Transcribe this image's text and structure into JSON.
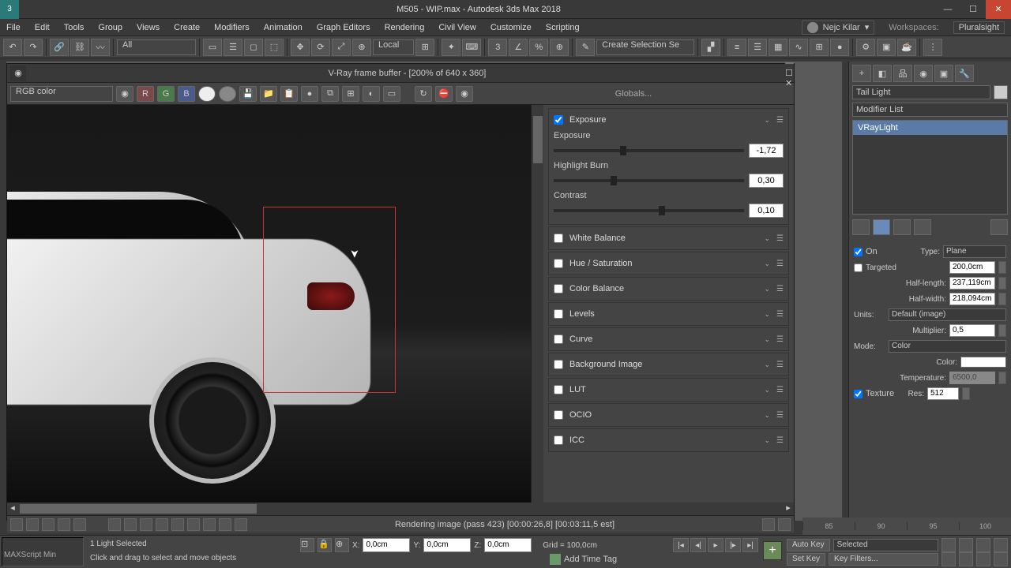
{
  "app": {
    "title": "M505 - WIP.max - Autodesk 3ds Max 2018"
  },
  "menu": {
    "items": [
      "File",
      "Edit",
      "Tools",
      "Group",
      "Views",
      "Create",
      "Modifiers",
      "Animation",
      "Graph Editors",
      "Rendering",
      "Civil View",
      "Customize",
      "Scripting"
    ],
    "user": "Nejc Kilar",
    "workspaces_label": "Workspaces:",
    "workspace": "Pluralsight"
  },
  "toolbar": {
    "selection_filter": "All",
    "coord_system": "Local",
    "named_selection": "Create Selection Se"
  },
  "vfb": {
    "title": "V-Ray frame buffer - [200% of 640 x 360]",
    "channel": "RGB color",
    "globals": "Globals...",
    "cc": {
      "exposure": {
        "title": "Exposure",
        "enabled": true,
        "params": {
          "exposure_label": "Exposure",
          "exposure_value": "-1,72",
          "highlight_label": "Highlight Burn",
          "highlight_value": "0,30",
          "contrast_label": "Contrast",
          "contrast_value": "0,10"
        }
      },
      "sections": [
        "White Balance",
        "Hue / Saturation",
        "Color Balance",
        "Levels",
        "Curve",
        "Background Image",
        "LUT",
        "OCIO",
        "ICC"
      ]
    },
    "status": "Rendering image (pass 423) [00:00:26,8] [00:03:11,5 est]"
  },
  "right": {
    "object_name": "Tail Light",
    "modifier_list": "Modifier List",
    "stack_item": "VRayLight",
    "params": {
      "on_label": "On",
      "type_label": "Type:",
      "type_value": "Plane",
      "targeted_label": "Targeted",
      "targeted_value": "200,0cm",
      "half_length_label": "Half-length:",
      "half_length_value": "237,119cm",
      "half_width_label": "Half-width:",
      "half_width_value": "218,094cm",
      "units_label": "Units:",
      "units_value": "Default (image)",
      "multiplier_label": "Multiplier:",
      "multiplier_value": "0,5",
      "mode_label": "Mode:",
      "mode_value": "Color",
      "color_label": "Color:",
      "temperature_label": "Temperature:",
      "temperature_value": "6500,0",
      "texture_label": "Texture",
      "res_label": "Res:",
      "res_value": "512"
    }
  },
  "timeline": {
    "ticks": [
      "85",
      "90",
      "95",
      "100"
    ]
  },
  "status": {
    "maxscript": "MAXScript Min",
    "selection": "1 Light Selected",
    "hint": "Click and drag to select and move objects",
    "x_label": "X:",
    "x_value": "0,0cm",
    "y_label": "Y:",
    "y_value": "0,0cm",
    "z_label": "Z:",
    "z_value": "0,0cm",
    "grid_label": "Grid = 100,0cm",
    "auto_key": "Auto Key",
    "set_key": "Set Key",
    "key_mode": "Selected",
    "key_filters": "Key Filters...",
    "add_time_tag": "Add Time Tag"
  }
}
